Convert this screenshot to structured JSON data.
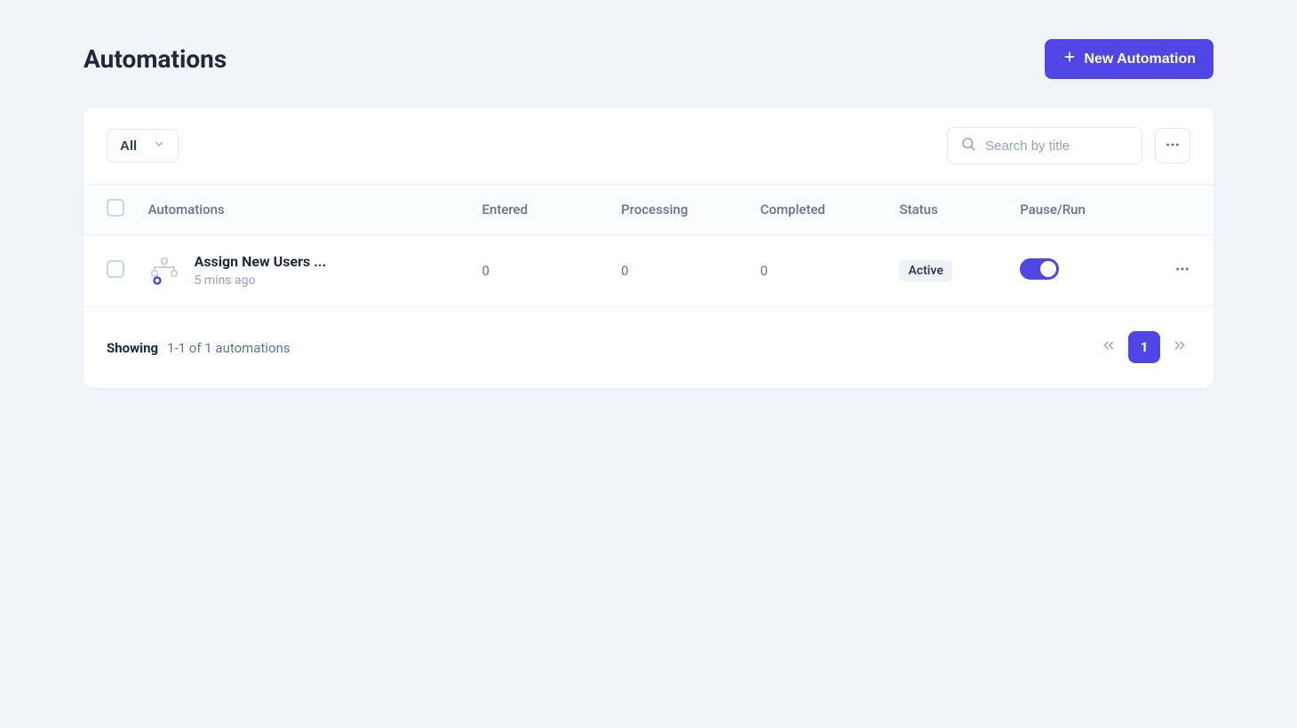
{
  "colors": {
    "accent": "#4f46e5",
    "bg": "#f1f4f8"
  },
  "header": {
    "title": "Automations",
    "new_button": "New Automation"
  },
  "toolbar": {
    "filter_label": "All",
    "search_placeholder": "Search by title"
  },
  "table": {
    "columns": {
      "automations": "Automations",
      "entered": "Entered",
      "processing": "Processing",
      "completed": "Completed",
      "status": "Status",
      "pause_run": "Pause/Run"
    },
    "rows": [
      {
        "title": "Assign New Users ...",
        "time": "5 mins ago",
        "entered": "0",
        "processing": "0",
        "completed": "0",
        "status": "Active",
        "running": true
      }
    ]
  },
  "footer": {
    "showing_label": "Showing",
    "showing_detail": "1-1 of 1 automations",
    "current_page": "1"
  }
}
